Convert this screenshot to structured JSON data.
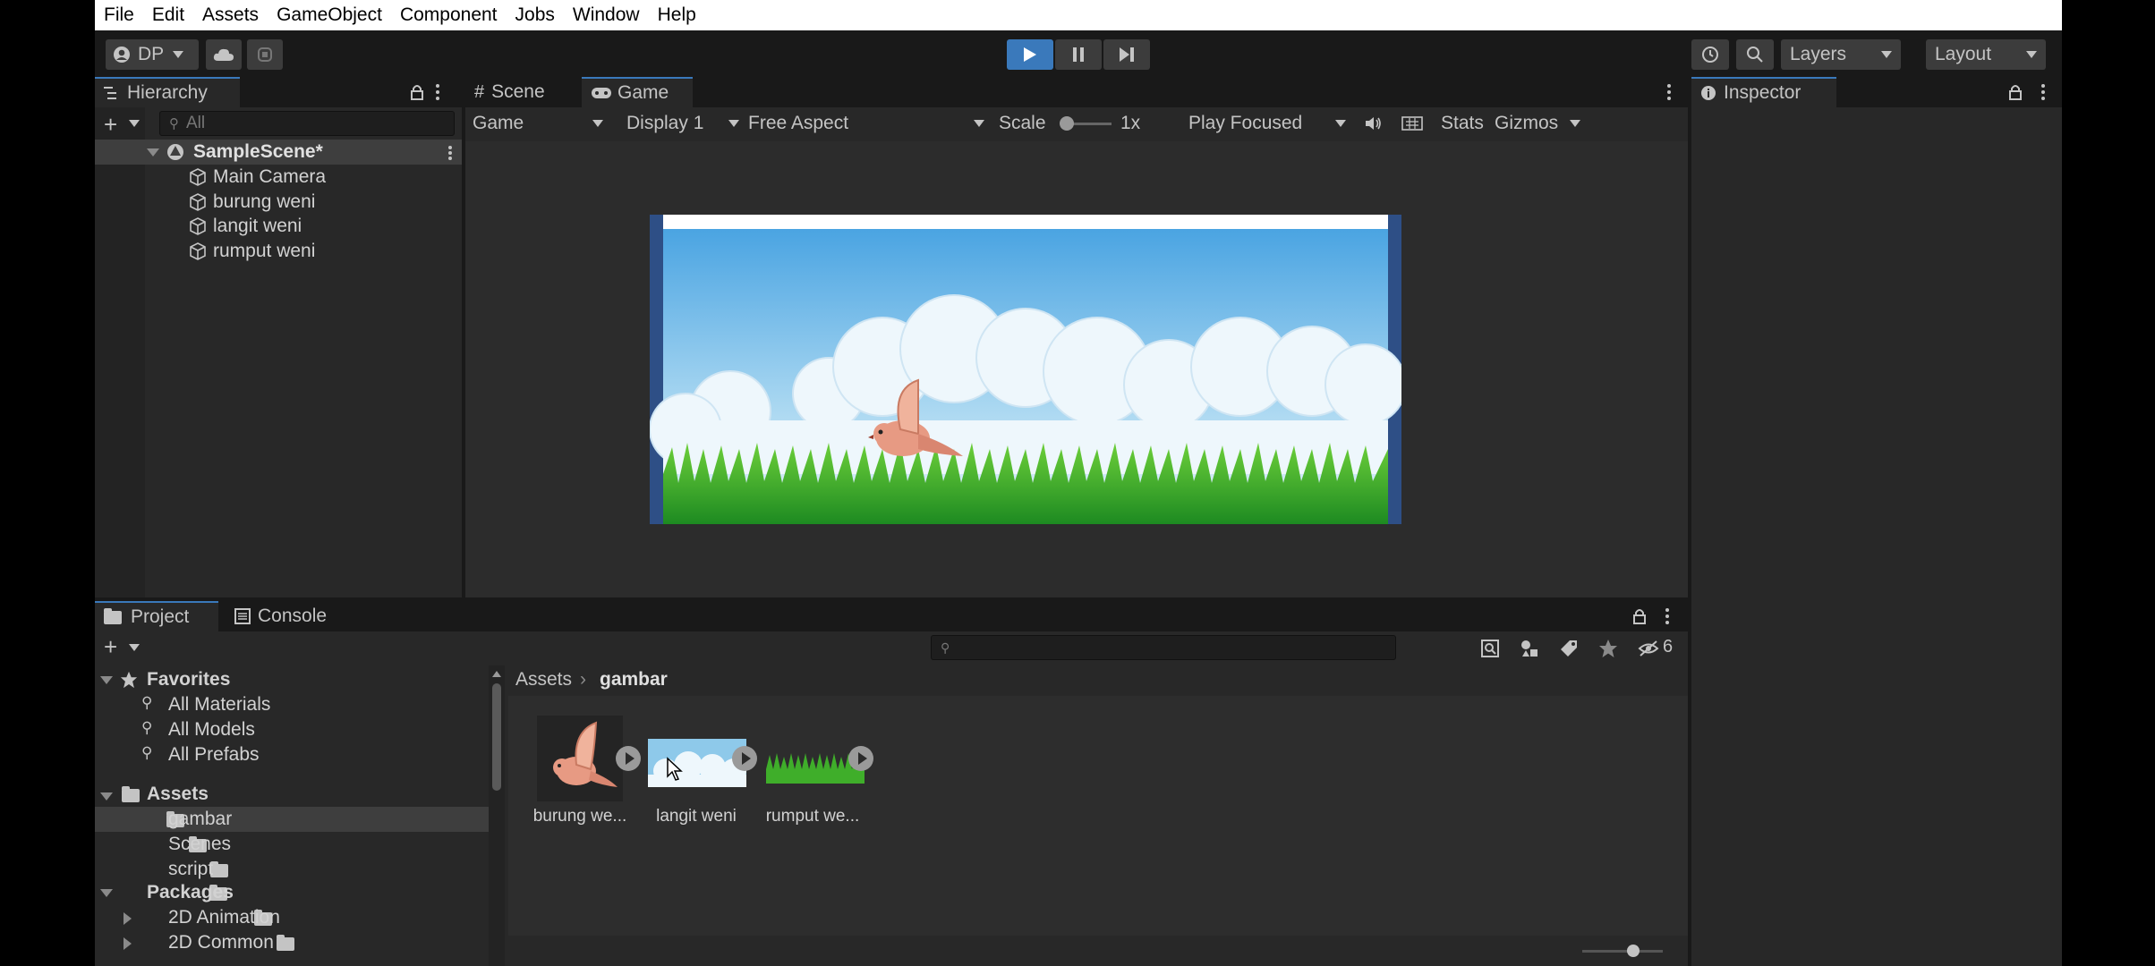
{
  "menu": [
    "File",
    "Edit",
    "Assets",
    "GameObject",
    "Component",
    "Jobs",
    "Window",
    "Help"
  ],
  "toolbar": {
    "account": "DP",
    "layers": "Layers",
    "layout": "Layout"
  },
  "hierarchy": {
    "tab": "Hierarchy",
    "search_placeholder": "All",
    "scene": "SampleScene*",
    "objects": [
      "Main Camera",
      "burung weni",
      "langit weni",
      "rumput weni"
    ]
  },
  "game_view": {
    "tabs": [
      "Scene",
      "Game"
    ],
    "mode": "Game",
    "display": "Display 1",
    "aspect": "Free Aspect",
    "scale_label": "Scale",
    "scale_value": "1x",
    "play_mode": "Play Focused",
    "stats": "Stats",
    "gizmos": "Gizmos"
  },
  "inspector": {
    "tab": "Inspector"
  },
  "project": {
    "tabs": [
      "Project",
      "Console"
    ],
    "hidden_count": "6",
    "favorites_label": "Favorites",
    "favorites": [
      "All Materials",
      "All Models",
      "All Prefabs"
    ],
    "assets_label": "Assets",
    "assets_folders": [
      "gambar",
      "Scenes",
      "script"
    ],
    "packages_label": "Packages",
    "packages": [
      "2D Animation",
      "2D Common"
    ],
    "breadcrumb": [
      "Assets",
      "gambar"
    ],
    "assets": [
      "burung we...",
      "langit weni",
      "rumput we..."
    ]
  },
  "colors": {
    "accent": "#3a79bb",
    "selection": "#3e5f96",
    "panel": "#282828",
    "sky": "#5ab0e6",
    "grass": "#3fae2a"
  }
}
